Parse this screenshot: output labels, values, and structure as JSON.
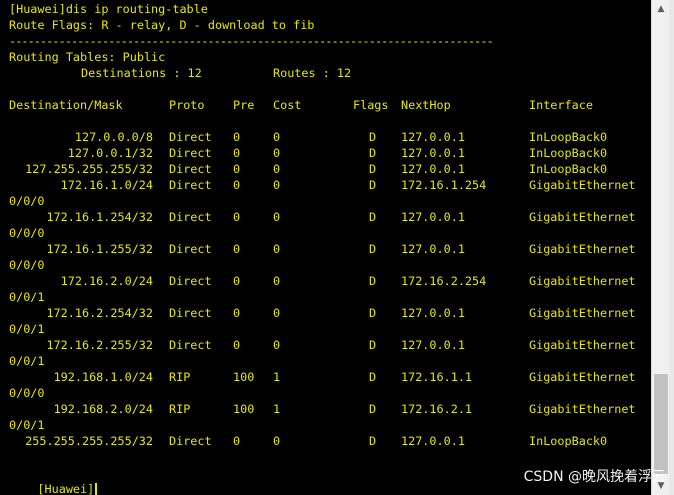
{
  "terminal": {
    "command_line": "[Huawei]dis ip routing-table",
    "flags_line": "Route Flags: R - relay, D - download to fib",
    "separator": "------------------------------------------------------------------------------",
    "tables_label": "Routing Tables: Public",
    "destinations_label": "Destinations : 12",
    "routes_label": "Routes : 12",
    "headers": {
      "destination": "Destination/Mask",
      "proto": "Proto",
      "pre": "Pre",
      "cost": "Cost",
      "flags": "Flags",
      "nexthop": "NextHop",
      "interface": "Interface"
    },
    "routes": [
      {
        "destination": "127.0.0.0/8",
        "proto": "Direct",
        "pre": "0",
        "cost": "0",
        "flags": "D",
        "nexthop": "127.0.0.1",
        "interface": "InLoopBack0",
        "wrap": ""
      },
      {
        "destination": "127.0.0.1/32",
        "proto": "Direct",
        "pre": "0",
        "cost": "0",
        "flags": "D",
        "nexthop": "127.0.0.1",
        "interface": "InLoopBack0",
        "wrap": ""
      },
      {
        "destination": "127.255.255.255/32",
        "proto": "Direct",
        "pre": "0",
        "cost": "0",
        "flags": "D",
        "nexthop": "127.0.0.1",
        "interface": "InLoopBack0",
        "wrap": ""
      },
      {
        "destination": "172.16.1.0/24",
        "proto": "Direct",
        "pre": "0",
        "cost": "0",
        "flags": "D",
        "nexthop": "172.16.1.254",
        "interface": "GigabitEthernet",
        "wrap": "0/0/0"
      },
      {
        "destination": "172.16.1.254/32",
        "proto": "Direct",
        "pre": "0",
        "cost": "0",
        "flags": "D",
        "nexthop": "127.0.0.1",
        "interface": "GigabitEthernet",
        "wrap": "0/0/0"
      },
      {
        "destination": "172.16.1.255/32",
        "proto": "Direct",
        "pre": "0",
        "cost": "0",
        "flags": "D",
        "nexthop": "127.0.0.1",
        "interface": "GigabitEthernet",
        "wrap": "0/0/0"
      },
      {
        "destination": "172.16.2.0/24",
        "proto": "Direct",
        "pre": "0",
        "cost": "0",
        "flags": "D",
        "nexthop": "172.16.2.254",
        "interface": "GigabitEthernet",
        "wrap": "0/0/1"
      },
      {
        "destination": "172.16.2.254/32",
        "proto": "Direct",
        "pre": "0",
        "cost": "0",
        "flags": "D",
        "nexthop": "127.0.0.1",
        "interface": "GigabitEthernet",
        "wrap": "0/0/1"
      },
      {
        "destination": "172.16.2.255/32",
        "proto": "Direct",
        "pre": "0",
        "cost": "0",
        "flags": "D",
        "nexthop": "127.0.0.1",
        "interface": "GigabitEthernet",
        "wrap": "0/0/1"
      },
      {
        "destination": "192.168.1.0/24",
        "proto": "RIP",
        "pre": "100",
        "cost": "1",
        "flags": "D",
        "nexthop": "172.16.1.1",
        "interface": "GigabitEthernet",
        "wrap": "0/0/0"
      },
      {
        "destination": "192.168.2.0/24",
        "proto": "RIP",
        "pre": "100",
        "cost": "1",
        "flags": "D",
        "nexthop": "172.16.2.1",
        "interface": "GigabitEthernet",
        "wrap": "0/0/1"
      },
      {
        "destination": "255.255.255.255/32",
        "proto": "Direct",
        "pre": "0",
        "cost": "0",
        "flags": "D",
        "nexthop": "127.0.0.1",
        "interface": "InLoopBack0",
        "wrap": ""
      }
    ],
    "prompt": "[Huawei]",
    "text_color": "#e8e800",
    "background_color": "#000000"
  },
  "scrollbar": {
    "up_icon": "triangle-up-icon",
    "down_icon": "triangle-down-icon",
    "scroll_fraction": 1.0
  },
  "watermark": "CSDN @晚风挽着浮云"
}
